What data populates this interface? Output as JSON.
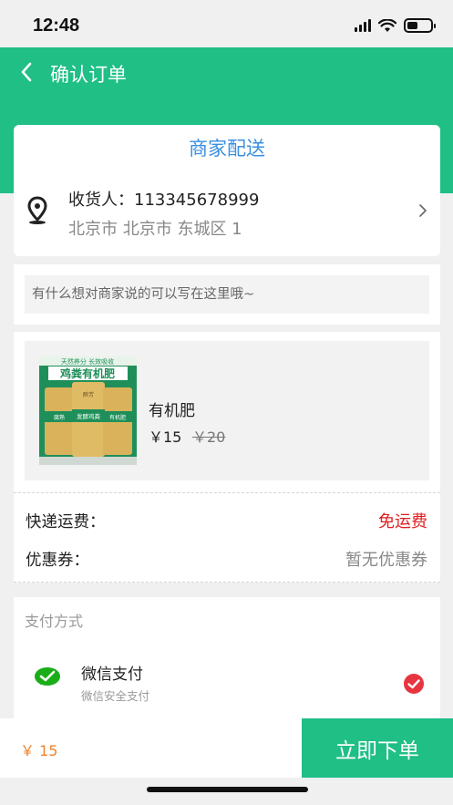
{
  "status_bar": {
    "time": "12:48"
  },
  "header": {
    "title": "确认订单",
    "back_icon": "chevron-left-icon"
  },
  "delivery": {
    "tab_label": "商家配送",
    "receiver": "收货人：113345678999",
    "address": "北京市 北京市 东城区 1"
  },
  "note": {
    "placeholder": "有什么想对商家说的可以写在这里哦~"
  },
  "product": {
    "name": "有机肥",
    "price": "￥15",
    "original_price": "￥20",
    "image_texts": {
      "top_banner": "天然养分 长效吸收",
      "title": "鸡粪有机肥",
      "bag_text_1": "发酵鸡粪",
      "bag_text_2": "腐熟",
      "bag_text_3": "有机肥",
      "brand": "醉芳"
    }
  },
  "shipping": {
    "label": "快递运费：",
    "value": "免运费",
    "value_color": "#e02020"
  },
  "coupon": {
    "label": "优惠券：",
    "value": "暂无优惠券"
  },
  "payment": {
    "section_title": "支付方式",
    "method": "微信支付",
    "subtitle": "微信安全支付",
    "selected": true
  },
  "bottom": {
    "total": "￥ 15",
    "submit_label": "立即下单"
  },
  "colors": {
    "brand_green": "#1fbf86",
    "link_blue": "#3b8fe0",
    "price_orange": "#f0832c",
    "check_red": "#e8343e"
  }
}
